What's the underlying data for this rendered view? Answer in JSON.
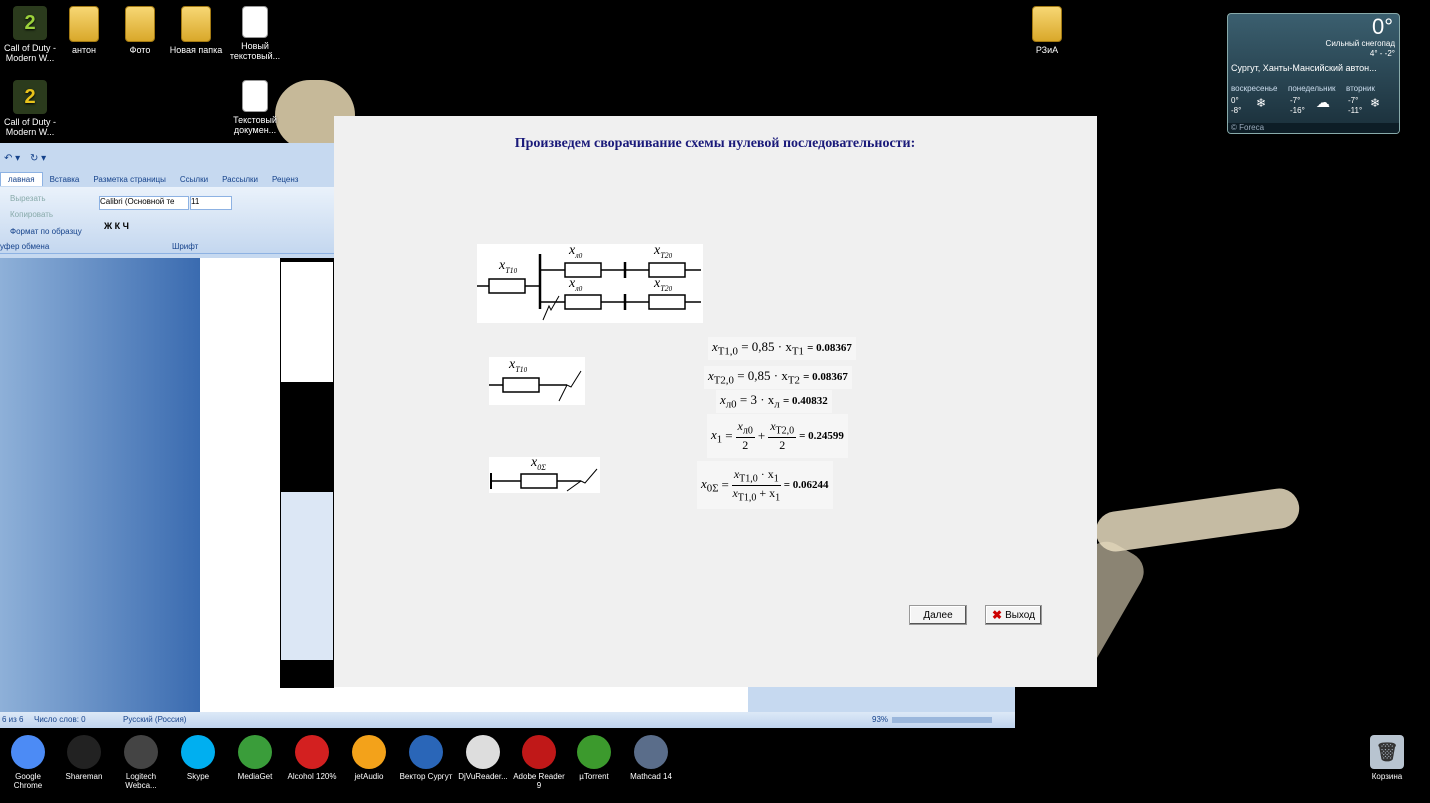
{
  "desktop_icons_top": [
    {
      "label": "Call of Duty - Modern W...",
      "kind": "cod"
    },
    {
      "label": "антон",
      "kind": "folder"
    },
    {
      "label": "Фото",
      "kind": "folder"
    },
    {
      "label": "Новая папка",
      "kind": "folder"
    },
    {
      "label": "Новый текстовый...",
      "kind": "text"
    }
  ],
  "desktop_icons_row2": [
    {
      "label": "Call of Duty - Modern W...",
      "kind": "cod"
    },
    {
      "label": "Текстовый докумен...",
      "kind": "text"
    }
  ],
  "desktop_icon_right": {
    "label": "РЗиА"
  },
  "weather": {
    "temp": "0°",
    "condition": "Сильный снегопад",
    "range": "4° - -2°",
    "location": "Сургут, Ханты-Мансийский автон...",
    "days": [
      {
        "day": "воскресенье",
        "hi": "0°",
        "lo": "-8°"
      },
      {
        "day": "понедельник",
        "hi": "-7°",
        "lo": "-16°"
      },
      {
        "day": "вторник",
        "hi": "-7°",
        "lo": "-11°"
      }
    ],
    "brand": "© Foreca"
  },
  "word": {
    "tabs": [
      "лавная",
      "Вставка",
      "Разметка страницы",
      "Ссылки",
      "Рассылки",
      "Реценз"
    ],
    "clipboard": {
      "cut": "Вырезать",
      "copy": "Копировать",
      "format_painter": "Формат по образцу",
      "group": "уфер обмена"
    },
    "font": {
      "name": "Calibri (Основной те",
      "size": "11",
      "group": "Шрифт"
    },
    "status": {
      "page": "6 из 6",
      "words": "Число слов: 0",
      "lang": "Русский (Россия)",
      "zoom": "93%"
    }
  },
  "dialog": {
    "title": "Произведем сворачивание схемы нулевой последовательности:",
    "diagram_labels": {
      "xt1": "x",
      "xt1_sub": "T1",
      "xl": "x",
      "xl_sub": "л",
      "xt2": "x",
      "xt2_sub": "T2",
      "zero": "0",
      "x0s": "x",
      "x0s_sub": "0Σ"
    },
    "formulas": {
      "f1": {
        "lhs": "x",
        "lhs_sub": "T1,0",
        "rhs": "= 0,85 · x",
        "rhs_sub": "T1",
        "result": "= 0.08367"
      },
      "f2": {
        "lhs": "x",
        "lhs_sub": "T2,0",
        "rhs": "= 0,85 · x",
        "rhs_sub": "T2",
        "result": "= 0.08367"
      },
      "f3": {
        "lhs": "x",
        "lhs_sub": "л0",
        "rhs": "= 3 · x",
        "rhs_sub": "л",
        "result": "= 0.40832"
      },
      "f4": {
        "lhs": "x",
        "lhs_sub": "1",
        "eq": "=",
        "n1": "x",
        "n1_sub": "л0",
        "d1": "2",
        "plus": "+",
        "n2": "x",
        "n2_sub": "T2,0",
        "d2": "2",
        "result": "= 0.24599"
      },
      "f5": {
        "lhs": "x",
        "lhs_sub": "0Σ",
        "eq": "=",
        "num": "x",
        "num_sub": "T1,0",
        "num_mid": " · x",
        "num_sub2": "1",
        "den": "x",
        "den_sub": "T1,0",
        "den_mid": " + x",
        "den_sub2": "1",
        "result": "= 0.06244"
      }
    },
    "buttons": {
      "next": "Далее",
      "exit": "Выход"
    }
  },
  "taskbar": [
    {
      "label": "Google Chrome",
      "color": "#4c8bf5"
    },
    {
      "label": "Shareman",
      "color": "#222222"
    },
    {
      "label": "Logitech Webca...",
      "color": "#444444"
    },
    {
      "label": "Skype",
      "color": "#00aff0"
    },
    {
      "label": "MediaGet",
      "color": "#3a9d3a"
    },
    {
      "label": "Alcohol 120%",
      "color": "#d32020"
    },
    {
      "label": "jetAudio",
      "color": "#f3a21a"
    },
    {
      "label": "Вектор Сургут",
      "color": "#2a66b8"
    },
    {
      "label": "DjVuReader...",
      "color": "#dddddd"
    },
    {
      "label": "Adobe Reader 9",
      "color": "#c01818"
    },
    {
      "label": "µTorrent",
      "color": "#3c9a2d"
    },
    {
      "label": "Mathcad 14",
      "color": "#5a6d8a"
    }
  ],
  "recycle_bin": {
    "label": "Корзина"
  }
}
